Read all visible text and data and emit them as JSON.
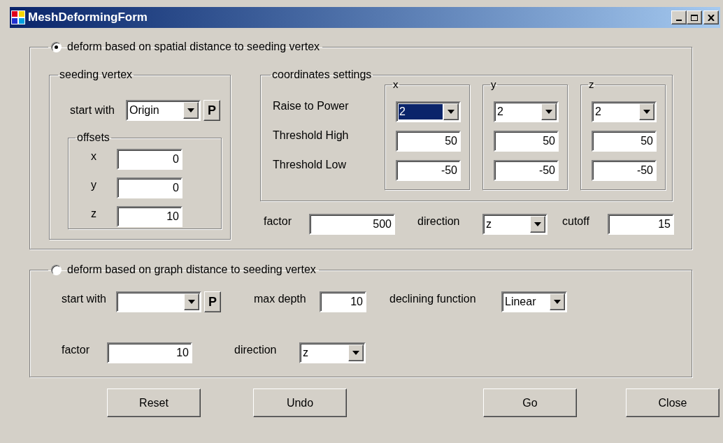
{
  "window": {
    "title": "MeshDeformingForm"
  },
  "spatial": {
    "label": "deform based on spatial distance to seeding vertex",
    "selected": true,
    "seeding": {
      "title": "seeding vertex",
      "start_label": "start with",
      "start_value": "Origin",
      "pick": "P",
      "offsets": {
        "title": "offsets",
        "fields": [
          {
            "label": "x",
            "value": "0"
          },
          {
            "label": "y",
            "value": "0"
          },
          {
            "label": "z",
            "value": "10"
          }
        ]
      }
    },
    "coords": {
      "title": "coordinates settings",
      "row_labels": [
        "Raise to Power",
        "Threshold High",
        "Threshold Low"
      ],
      "axes": [
        {
          "title": "x",
          "power": "2",
          "focused": true,
          "high": "50",
          "low": "-50"
        },
        {
          "title": "y",
          "power": "2",
          "focused": false,
          "high": "50",
          "low": "-50"
        },
        {
          "title": "z",
          "power": "2",
          "focused": false,
          "high": "50",
          "low": "-50"
        }
      ]
    },
    "factor_label": "factor",
    "factor": "500",
    "direction_label": "direction",
    "direction": "z",
    "cutoff_label": "cutoff",
    "cutoff": "15"
  },
  "graph": {
    "label": "deform based on graph distance to seeding vertex",
    "selected": false,
    "start_label": "start with",
    "pick": "P",
    "depth_label": "max depth",
    "depth": "10",
    "declining_label": "declining function",
    "declining": "Linear",
    "factor_label": "factor",
    "factor": "10",
    "direction_label": "direction",
    "direction": "z"
  },
  "buttons": [
    "Reset",
    "Undo",
    "Go",
    "Close"
  ]
}
